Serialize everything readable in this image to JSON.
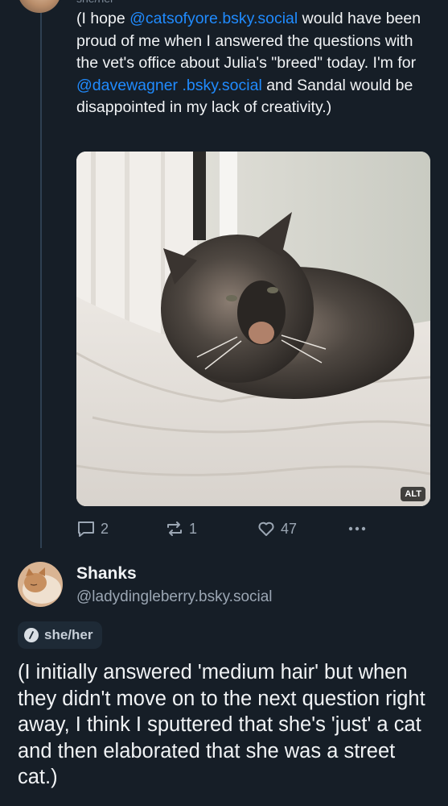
{
  "parent_post": {
    "pronoun_cut": "she/her",
    "text_parts": [
      {
        "text": "(I hope ",
        "type": "text"
      },
      {
        "text": "@catsofyore.bsky.social",
        "type": "mention"
      },
      {
        "text": " would have been proud of me when I answered the questions with the vet's office about Julia's \"breed\" today. I'm for ",
        "type": "text"
      },
      {
        "text": "@davewagner .bsky.social",
        "type": "mention"
      },
      {
        "text": " and Sandal would be disappointed in my lack of creativity.)",
        "type": "text"
      }
    ],
    "image_alt_badge": "ALT",
    "replies": "2",
    "reposts": "1",
    "likes": "47",
    "icons": {
      "reply": "reply-icon",
      "repost": "repost-icon",
      "like": "heart-icon",
      "more": "more-options-icon"
    }
  },
  "reply_post": {
    "author_name": "Shanks",
    "author_handle": "@ladydingleberry.bsky.social",
    "pronouns": "she/her",
    "text": "(I initially answered 'medium hair' but when they didn't move on to the next question right away, I think I sputtered that she's 'just' a cat and then elaborated that she was a street cat.)"
  },
  "colors": {
    "background": "#161e27",
    "mention": "#208bfe",
    "muted": "#9ba6b3"
  }
}
